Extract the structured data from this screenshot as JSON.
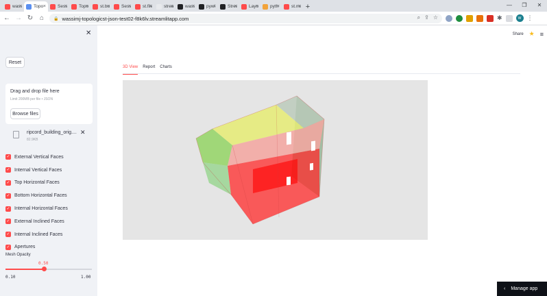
{
  "browser": {
    "tabs": [
      {
        "label": "wass",
        "icon": "streamlit-icon",
        "color": "#ff4b4b"
      },
      {
        "label": "Topo",
        "icon": "page-icon",
        "color": "#5a8ff0",
        "active": true
      },
      {
        "label": "Sess",
        "icon": "streamlit-icon",
        "color": "#ff4b4b"
      },
      {
        "label": "Topo",
        "icon": "streamlit-icon",
        "color": "#ff4b4b"
      },
      {
        "label": "st.bu",
        "icon": "streamlit-icon",
        "color": "#ff4b4b"
      },
      {
        "label": "Sess",
        "icon": "streamlit-icon",
        "color": "#ff4b4b"
      },
      {
        "label": "st.file",
        "icon": "streamlit-icon",
        "color": "#ff4b4b"
      },
      {
        "label": "strea",
        "icon": "blank-page-icon",
        "color": "#e8eaed"
      },
      {
        "label": "wass",
        "icon": "github-icon",
        "color": "#202124"
      },
      {
        "label": "pywi",
        "icon": "github-icon",
        "color": "#202124"
      },
      {
        "label": "Strea",
        "icon": "streamlit-dark-icon",
        "color": "#202124"
      },
      {
        "label": "Layo",
        "icon": "streamlit-icon",
        "color": "#ff4b4b"
      },
      {
        "label": "pyth",
        "icon": "python-icon",
        "color": "#f2a33a"
      },
      {
        "label": "st.ma",
        "icon": "streamlit-icon",
        "color": "#ff4b4b"
      }
    ],
    "new_tab": "+",
    "window_controls": [
      "—",
      "❐",
      "✕"
    ],
    "url": "wassimj-topologicst-json-test02-f8k6lv.streamlitapp.com",
    "back": "←",
    "forward": "→",
    "reload": "↻",
    "home": "⌂"
  },
  "sidebar": {
    "close": "✕",
    "reset_label": "Reset",
    "uploader": {
      "title": "Drag and drop file here",
      "limit": "Limit 200MB per file • JSON",
      "browse_label": "Browse files"
    },
    "file": {
      "name": "ripcord_building_orig....",
      "size": "82.9KB",
      "remove": "✕"
    },
    "checkboxes": [
      {
        "label": "External Vertical Faces",
        "checked": true
      },
      {
        "label": "Internal Vertical Faces",
        "checked": true
      },
      {
        "label": "Top Horizontal Faces",
        "checked": true
      },
      {
        "label": "Bottom Horizontal Faces",
        "checked": true
      },
      {
        "label": "Internal Horizontal Faces",
        "checked": true
      },
      {
        "label": "External Inclined Faces",
        "checked": true
      },
      {
        "label": "Internal Inclined Faces",
        "checked": true
      },
      {
        "label": "Apertures",
        "checked": true
      }
    ],
    "slider": {
      "label": "Mesh Opacity",
      "value": "0.50",
      "min": "0.10",
      "max": "1.00",
      "fraction": 0.444
    }
  },
  "main": {
    "share": "Share",
    "tabs": [
      {
        "label": "3D View",
        "active": true
      },
      {
        "label": "Report",
        "active": false
      },
      {
        "label": "Charts",
        "active": false
      }
    ],
    "manage_app": "Manage app"
  },
  "colors": {
    "accent": "#ff4b4b",
    "sidebar_bg": "#f0f2f6",
    "viewport_bg": "#e5e5e5"
  }
}
